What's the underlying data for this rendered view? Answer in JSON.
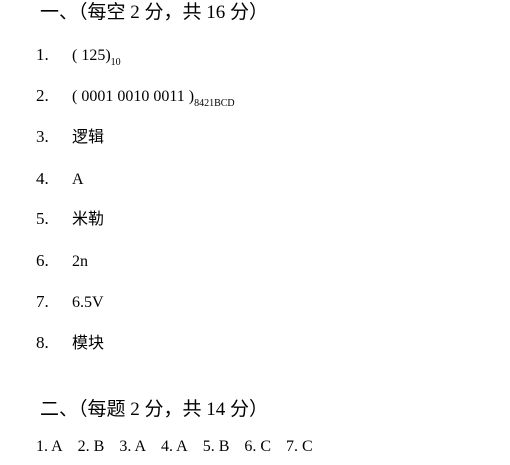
{
  "section1": {
    "title": "一、（每空 2 分，共 16 分）",
    "items": [
      {
        "num": "1.",
        "answer": "( 125)",
        "sub": "10"
      },
      {
        "num": "2.",
        "answer": "( 0001 0010 0011 )",
        "sub": "8421BCD"
      },
      {
        "num": "3.",
        "answer": "逻辑"
      },
      {
        "num": "4.",
        "answer": "A"
      },
      {
        "num": "5.",
        "answer": "米勒"
      },
      {
        "num": "6.",
        "answer": "2n"
      },
      {
        "num": "7.",
        "answer": "6.5V"
      },
      {
        "num": "8.",
        "answer": "模块"
      }
    ]
  },
  "section2": {
    "title": "二、（每题 2 分，共 14 分）",
    "answers": [
      "1. A",
      "2. B",
      "3. A",
      "4. A",
      "5. B",
      "6. C",
      "7. C"
    ]
  }
}
